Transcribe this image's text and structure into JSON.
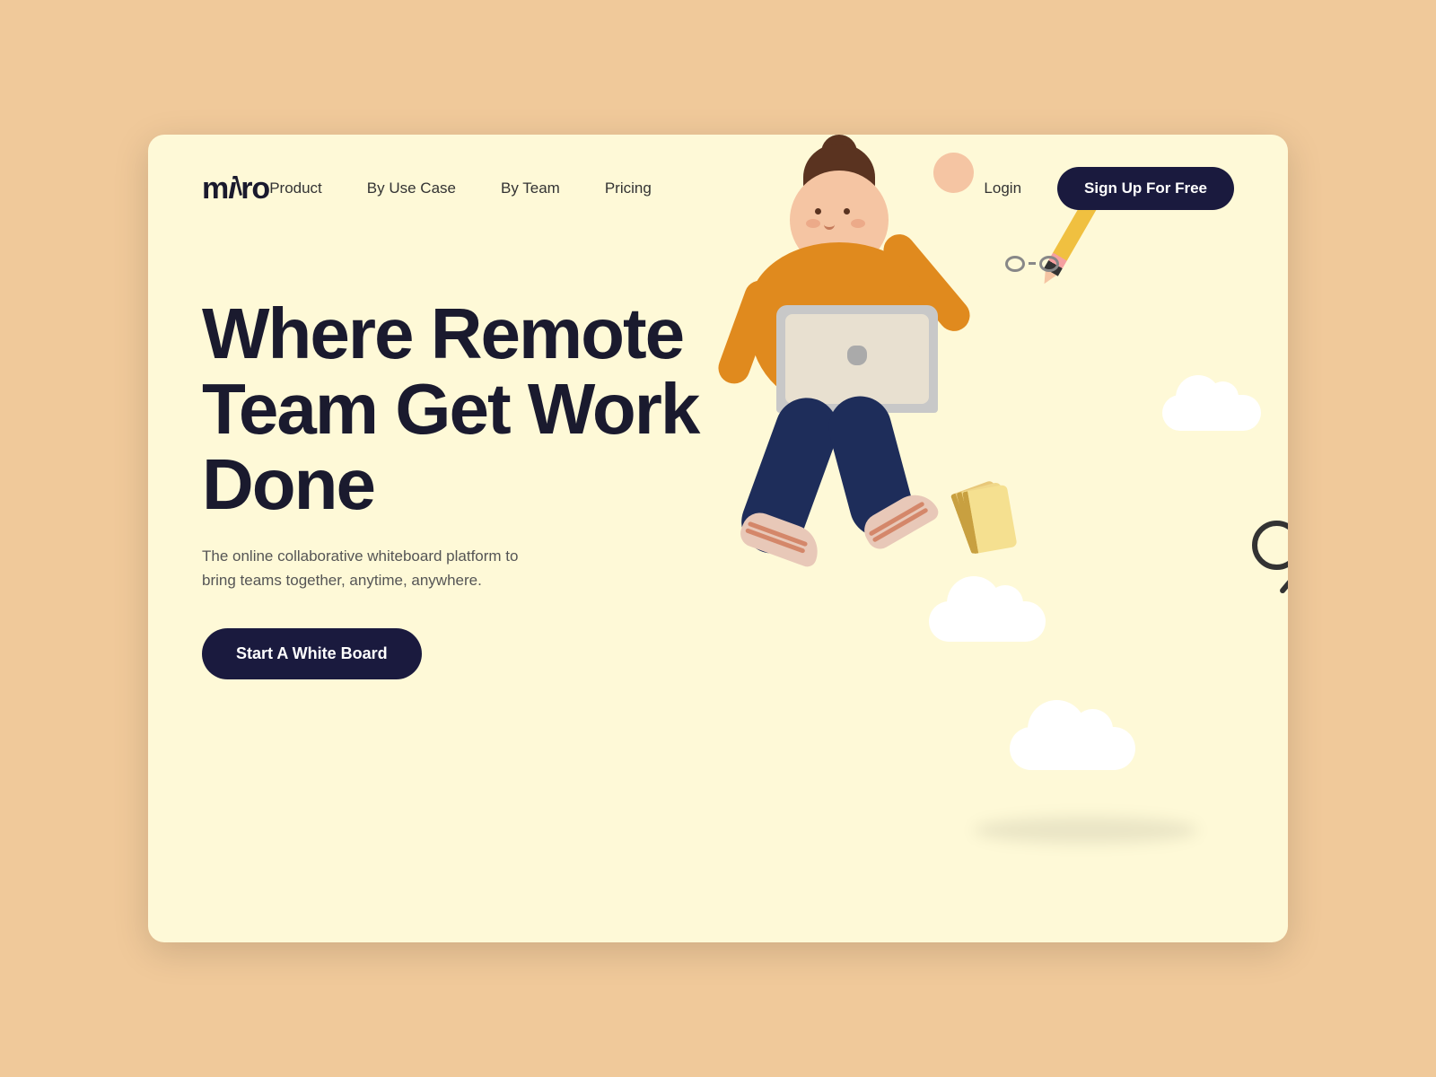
{
  "page": {
    "background_color": "#f0c99a",
    "card_background": "#fef9d7"
  },
  "navbar": {
    "logo_text": "míro",
    "links": [
      {
        "label": "Product",
        "id": "product"
      },
      {
        "label": "By Use Case",
        "id": "by-use-case"
      },
      {
        "label": "By Team",
        "id": "by-team"
      },
      {
        "label": "Pricing",
        "id": "pricing"
      }
    ],
    "login_label": "Login",
    "signup_label": "Sign Up For Free"
  },
  "hero": {
    "heading_line1": "Where Remote",
    "heading_line2": "Team Get Work Done",
    "subtext": "The online collaborative whiteboard platform to bring teams together, anytime, anywhere.",
    "cta_label": "Start A White Board"
  }
}
